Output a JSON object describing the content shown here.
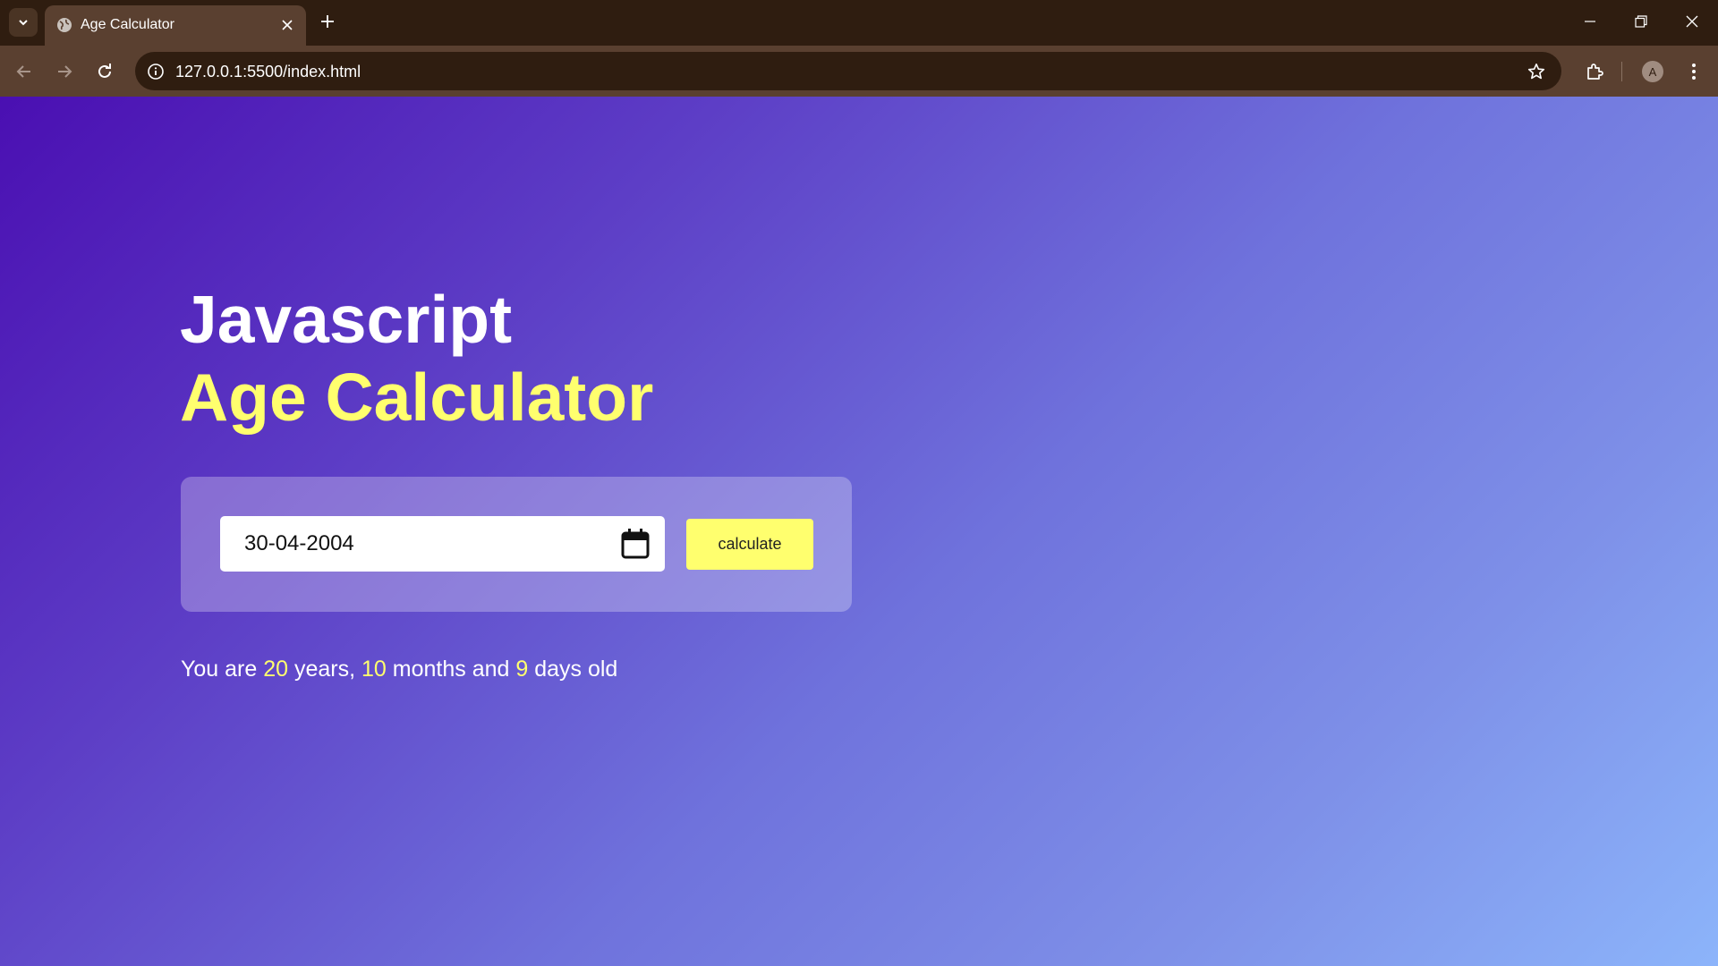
{
  "browser": {
    "tab_title": "Age Calculator",
    "url": "127.0.0.1:5500/index.html",
    "profile_initial": "A"
  },
  "page": {
    "heading_line1": "Javascript",
    "heading_line2": "Age Calculator",
    "date_value": "30-04-2004",
    "calculate_label": "calculate",
    "result": {
      "prefix": "You are ",
      "years": "20",
      "years_label": " years, ",
      "months": "10",
      "months_label": " months and ",
      "days": "9",
      "days_label": " days old"
    }
  },
  "colors": {
    "accent_yellow": "#ffff6e",
    "gradient_start": "#4a0fb2",
    "gradient_end": "#8cb4fa",
    "chrome_dark": "#2f1d10",
    "chrome_toolbar": "#5a4030"
  },
  "icons": [
    "chevron-down-icon",
    "globe-icon",
    "close-icon",
    "plus-icon",
    "minimize-icon",
    "restore-icon",
    "back-arrow-icon",
    "forward-arrow-icon",
    "reload-icon",
    "info-icon",
    "star-icon",
    "extensions-icon",
    "menu-icon",
    "calendar-icon"
  ]
}
